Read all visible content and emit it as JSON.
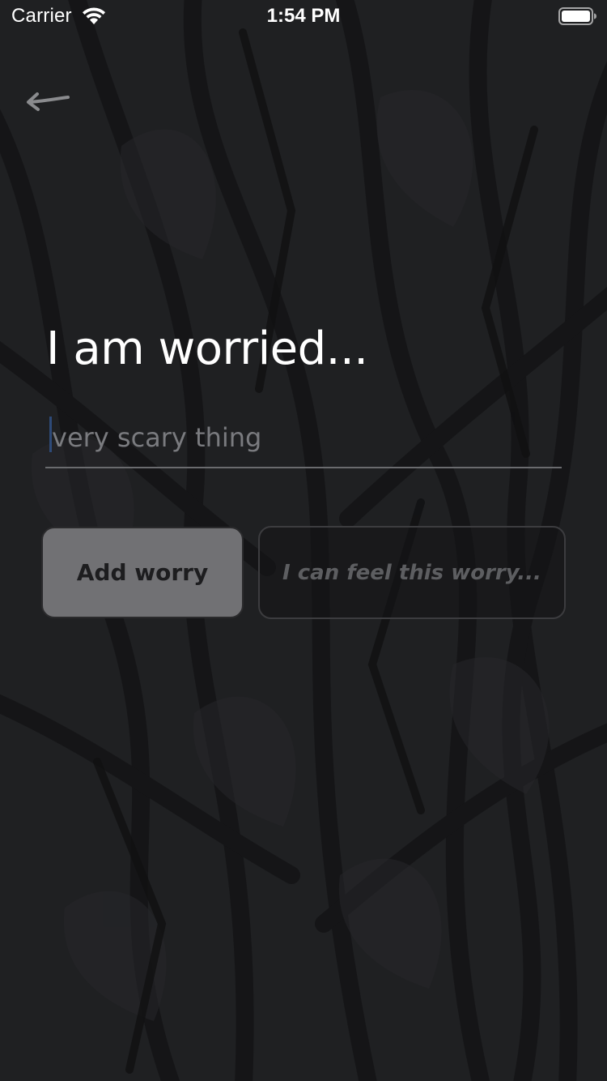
{
  "status_bar": {
    "carrier": "Carrier",
    "time": "1:54 PM",
    "wifi_icon": "wifi-icon",
    "battery_icon": "battery-full-icon"
  },
  "nav": {
    "back_icon": "arrow-left-icon"
  },
  "main": {
    "title": "I am worried...",
    "input": {
      "value": "",
      "placeholder": "very scary thing"
    },
    "add_button_label": "Add worry",
    "feel_button_label": "I can feel this worry..."
  },
  "colors": {
    "background": "#1f2022",
    "add_button": "#717174",
    "feel_button_text": "#5d5e61",
    "title_text": "#ffffff"
  }
}
